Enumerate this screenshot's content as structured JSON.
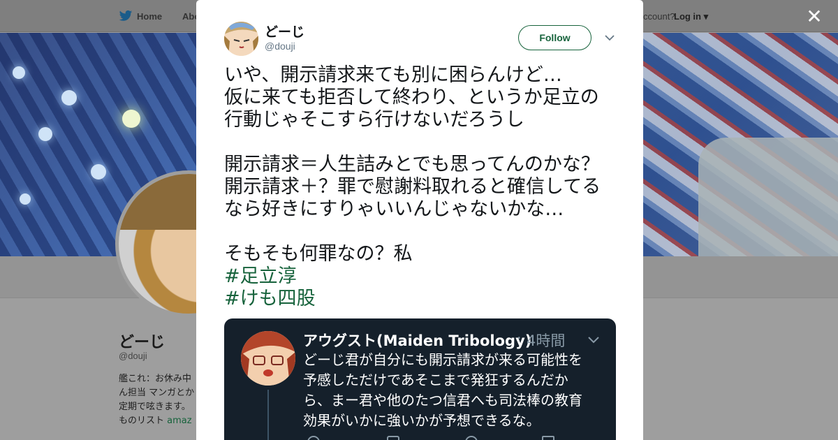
{
  "background": {
    "nav": {
      "home_label": "Home",
      "about_label": "Abo",
      "account_label": "ccount?",
      "login_label": "Log in"
    },
    "profile": {
      "name": "どーじ",
      "handle": "@douji",
      "bio_lines": [
        "艦これ：お休み中",
        "ん担当 マンガとか",
        "定期で呟きます。",
        "ものリスト "
      ],
      "bio_link": "amaz"
    }
  },
  "modal": {
    "close_icon": "close-icon",
    "author": {
      "name": "どーじ",
      "handle": "@douji"
    },
    "follow_label": "Follow",
    "tweet_lines": [
      "いや、開示請求来ても別に困らんけど…",
      "仮に来ても拒否して終わり、というか足立の",
      "行動じゃそこすら行けないだろうし",
      "",
      "開示請求＝人生詰みとでも思ってんのかな？",
      "開示請求＋？罪で慰謝料取れると確信してる",
      "なら好きにすりゃいいんじゃないかな…",
      "",
      "そもそも何罪なの？私"
    ],
    "hashtags": [
      "#足立淳",
      "#けも四股"
    ],
    "embed": {
      "name": "アウグスト(Maiden Tribology)",
      "separator": "·",
      "time": "4時間",
      "text_lines": [
        "どーじ君が自分にも開示請求が来る可能性を",
        "予感しただけであそこまで発狂するんだか",
        "ら、まー君や他のたつ信君へも司法棒の教育",
        "効果がいかに強いかが予想できるな。"
      ]
    }
  },
  "colors": {
    "accent": "#17633c",
    "embed_bg": "#15202b",
    "muted": "#657786"
  }
}
